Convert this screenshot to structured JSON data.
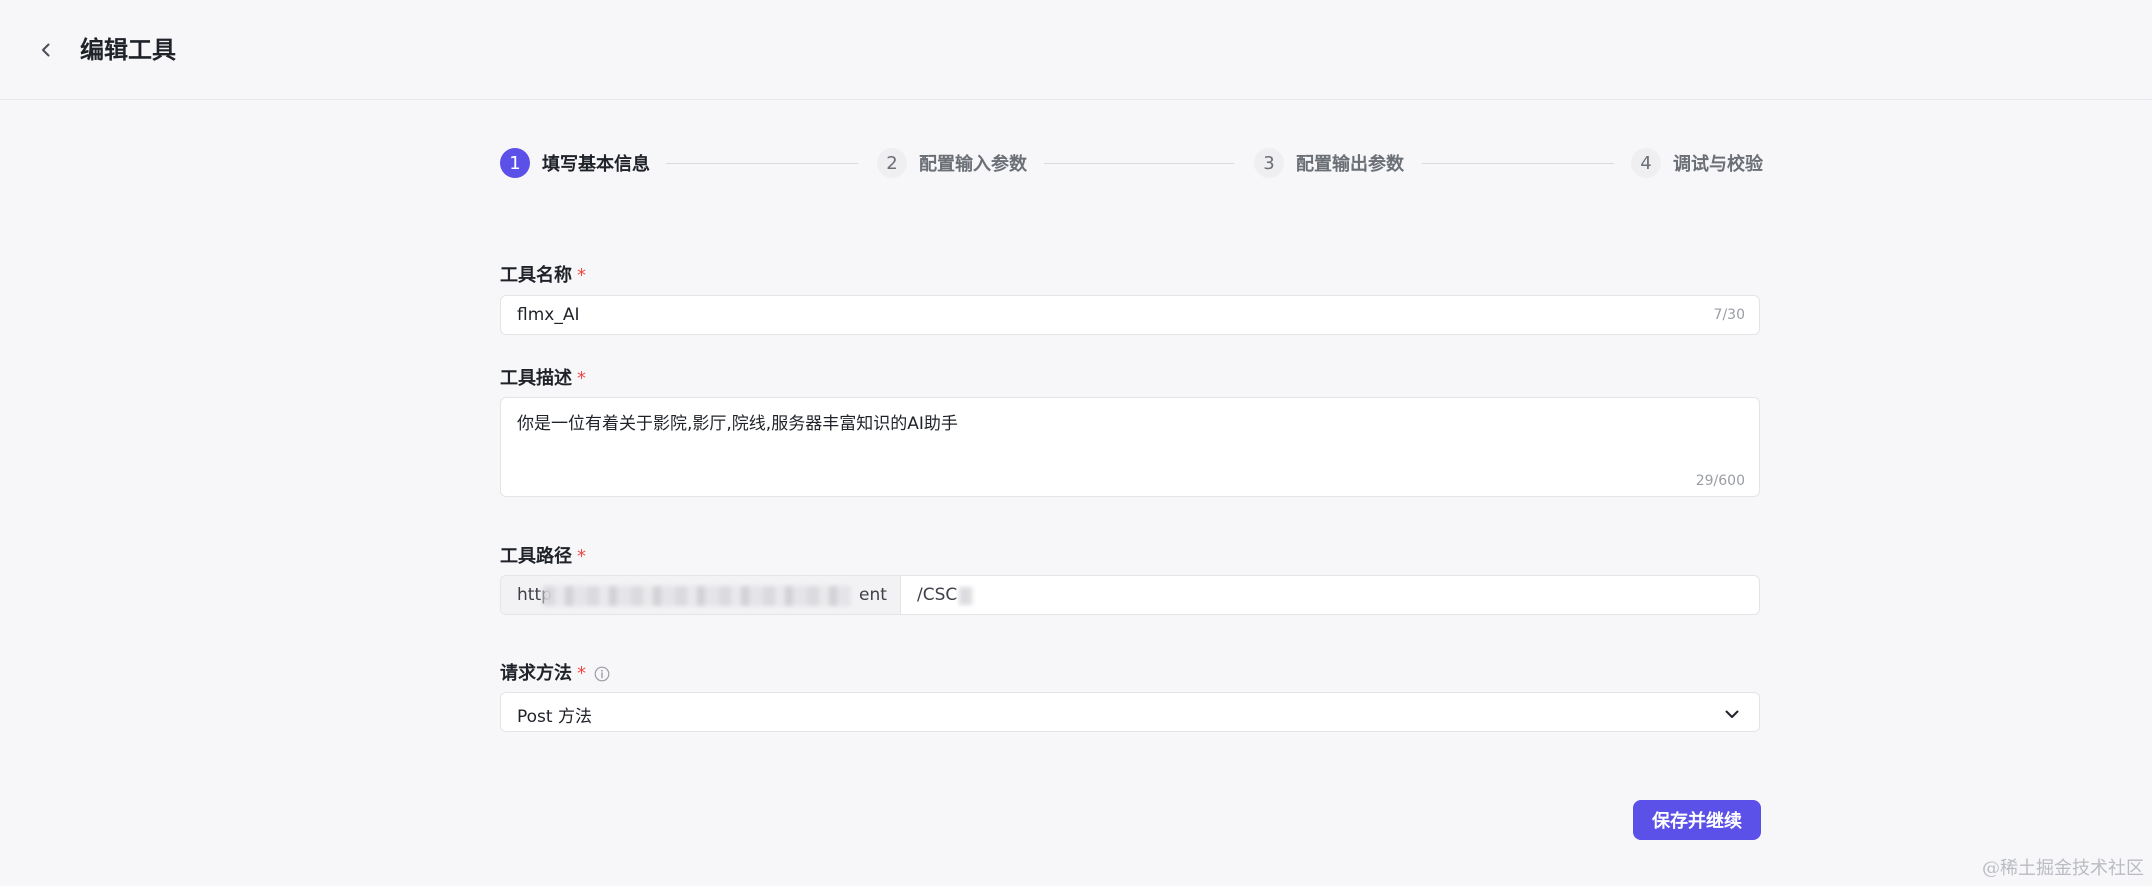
{
  "header": {
    "title": "编辑工具",
    "back_icon": "chevron-left-icon"
  },
  "steps": [
    {
      "number": "1",
      "label": "填写基本信息",
      "state": "active"
    },
    {
      "number": "2",
      "label": "配置输入参数",
      "state": "inactive"
    },
    {
      "number": "3",
      "label": "配置输出参数",
      "state": "inactive"
    },
    {
      "number": "4",
      "label": "调试与校验",
      "state": "inactive"
    }
  ],
  "form": {
    "name": {
      "label": "工具名称",
      "required_mark": "*",
      "value": "flmx_AI",
      "counter": "7/30"
    },
    "description": {
      "label": "工具描述",
      "required_mark": "*",
      "value": "你是一位有着关于影院,影厅,院线,服务器丰富知识的AI助手",
      "counter": "29/600"
    },
    "path": {
      "label": "工具路径",
      "required_mark": "*",
      "prefix_start": "http",
      "prefix_end": "ent",
      "value": "/CSC"
    },
    "method": {
      "label": "请求方法",
      "required_mark": "*",
      "info_icon": "info-circle-icon",
      "selected": "Post 方法",
      "dropdown_icon": "chevron-down-icon"
    }
  },
  "actions": {
    "save_continue": "保存并继续"
  },
  "watermark": "@稀土掘金技术社区",
  "colors": {
    "accent": "#5b50e8",
    "required": "#f04848",
    "background": "#f7f7f9"
  }
}
